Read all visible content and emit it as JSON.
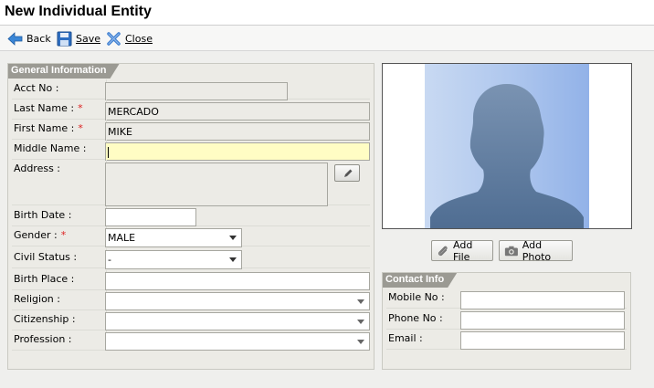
{
  "window": {
    "title": "New Individual Entity"
  },
  "toolbar": {
    "back_label": "Back",
    "save_label": "Save",
    "close_label": "Close"
  },
  "general": {
    "title": "General Information",
    "acct_no": {
      "label": "Acct No :",
      "value": ""
    },
    "last_name": {
      "label": "Last Name :",
      "value": "MERCADO"
    },
    "first_name": {
      "label": "First Name :",
      "value": "MIKE"
    },
    "middle_name": {
      "label": "Middle Name :",
      "value": ""
    },
    "address": {
      "label": "Address :",
      "value": ""
    },
    "birth_date": {
      "label": "Birth Date :",
      "value": ""
    },
    "gender": {
      "label": "Gender :",
      "value": "MALE"
    },
    "civil_status": {
      "label": "Civil Status :",
      "value": "-"
    },
    "birth_place": {
      "label": "Birth Place :",
      "value": ""
    },
    "religion": {
      "label": "Religion :",
      "value": ""
    },
    "citizenship": {
      "label": "Citizenship :",
      "value": ""
    },
    "profession": {
      "label": "Profession :",
      "value": ""
    },
    "required_marker": "*"
  },
  "photo": {
    "add_file_label": "Add File",
    "add_photo_label": "Add Photo"
  },
  "contact": {
    "title": "Contact Info",
    "mobile_no": {
      "label": "Mobile No :",
      "value": ""
    },
    "phone_no": {
      "label": "Phone No :",
      "value": ""
    },
    "email": {
      "label": "Email :",
      "value": ""
    }
  },
  "colors": {
    "panel_header": "#9b9a93",
    "focus_field": "#fffdc4",
    "required": "#dd2222",
    "silhouette": "#5e7a9c"
  }
}
